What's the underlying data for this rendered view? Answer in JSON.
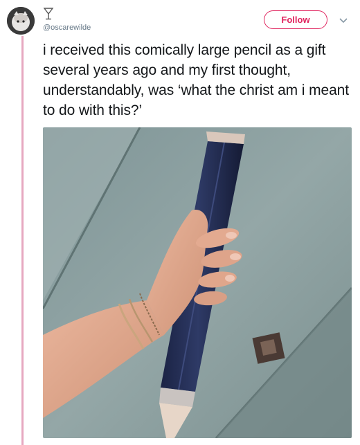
{
  "tweet": {
    "handle": "@oscarewilde",
    "text": "i received this comically large pencil as a gift several years ago and my first thought, understandably, was ‘what the christ am i meant to do with this?’",
    "follow_label": "Follow"
  },
  "icons": {
    "avatar": "avatar-photo",
    "badge": "martini-glass-icon",
    "menu": "chevron-down-icon"
  },
  "colors": {
    "accent": "#e0245e",
    "thread_line": "#e6a8c0",
    "text": "#14171a",
    "muted": "#657786"
  }
}
